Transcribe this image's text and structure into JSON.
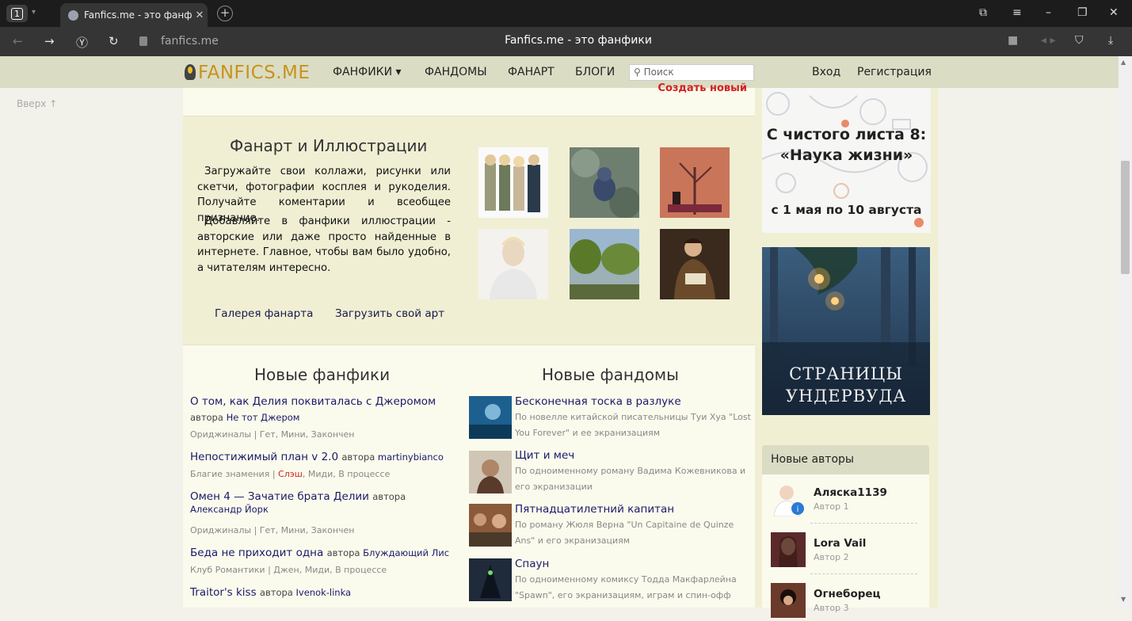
{
  "browser": {
    "tab_count": "1",
    "tab_title": "Fanfics.me - это фанфи",
    "url": "fanfics.me",
    "page_title": "Fanfics.me - это фанфики"
  },
  "header": {
    "logo": "FANFICS.ME",
    "nav": [
      "ФАНФИКИ ▾",
      "ФАНДОМЫ",
      "ФАНАРТ",
      "БЛОГИ"
    ],
    "search_placeholder": "⚲ Поиск",
    "login": "Вход",
    "register": "Регистрация"
  },
  "up_link": "Вверх ↑",
  "create_fandom": "Создать новый фандом",
  "fanart": {
    "title": "Фанарт и Иллюстрации",
    "para1": "Загружайте свои коллажи, рисунки или скетчи, фотографии косплея и рукоделия. Получайте коментарии и всеобщее признание.",
    "para2": "Добавляйте в фанфики иллюстрации - авторские или даже просто найденные в интернете. Главное, чтобы вам было удобно, а читателям интересно.",
    "gallery_link": "Галерея фанарта",
    "upload_link": "Загрузить свой арт"
  },
  "new_fanfics": {
    "title": "Новые фанфики",
    "items": [
      {
        "title": "О том, как Делия поквиталась с Джеромом",
        "author_prefix": "автора",
        "author": "Не тот Джером",
        "meta": "Ориджиналы | Гет, Мини, Закончен",
        "meta_flag": ""
      },
      {
        "title": "Непостижимый план v 2.0",
        "author_prefix": "автора",
        "author": "martinybianco",
        "meta_pre": "Благие знамения | ",
        "meta_flag": "Слэш",
        "meta_post": ", Миди, В процессе"
      },
      {
        "title": "Омен 4 — Зачатие брата Делии",
        "author_prefix": "автора",
        "author": "Александр Йорк",
        "meta": "Ориджиналы | Гет, Мини, Закончен"
      },
      {
        "title": "Беда не приходит одна",
        "author_prefix": "автора",
        "author": "Блуждающий Лис",
        "meta": "Клуб Романтики | Джен, Миди, В процессе"
      },
      {
        "title": "Traitor's kiss",
        "author_prefix": "автора",
        "author": "Ivenok-linka"
      }
    ]
  },
  "new_fandoms": {
    "title": "Новые фандомы",
    "items": [
      {
        "title": "Бесконечная тоска в разлуке",
        "desc": "По новелле китайской писательницы Туи Хуа \"Lost You Forever\" и ее экранизациям",
        "color": "#1d5f8f"
      },
      {
        "title": "Щит и меч",
        "desc": "По одноименному роману Вадима Кожевникова и его экранизации",
        "color": "#6b4a35"
      },
      {
        "title": "Пятнадцатилетний капитан",
        "desc": "По роману Жюля Верна \"Un Capitaine de Quinze Ans\" и его экранизациям",
        "color": "#8a5a3a"
      },
      {
        "title": "Спаун",
        "desc": "По одноименному комиксу Тодда Макфарлейна \"Spawn\", его экранизациям, играм и спин-офф",
        "color": "#1f2a3a"
      }
    ]
  },
  "ads": {
    "ad1_line1": "С чистого листа 8:",
    "ad1_line2": "«Наука жизни»",
    "ad1_date": "с 1 мая по 10 августа",
    "ad2_line1": "СТРАНИЦЫ",
    "ad2_line2": "УНДЕРВУДА"
  },
  "new_authors": {
    "title": "Новые авторы",
    "items": [
      {
        "name": "Аляска1139",
        "sub": "Автор 1"
      },
      {
        "name": "Lora Vail",
        "sub": "Автор 2"
      },
      {
        "name": "Огнеборец",
        "sub": "Автор 3"
      }
    ]
  }
}
